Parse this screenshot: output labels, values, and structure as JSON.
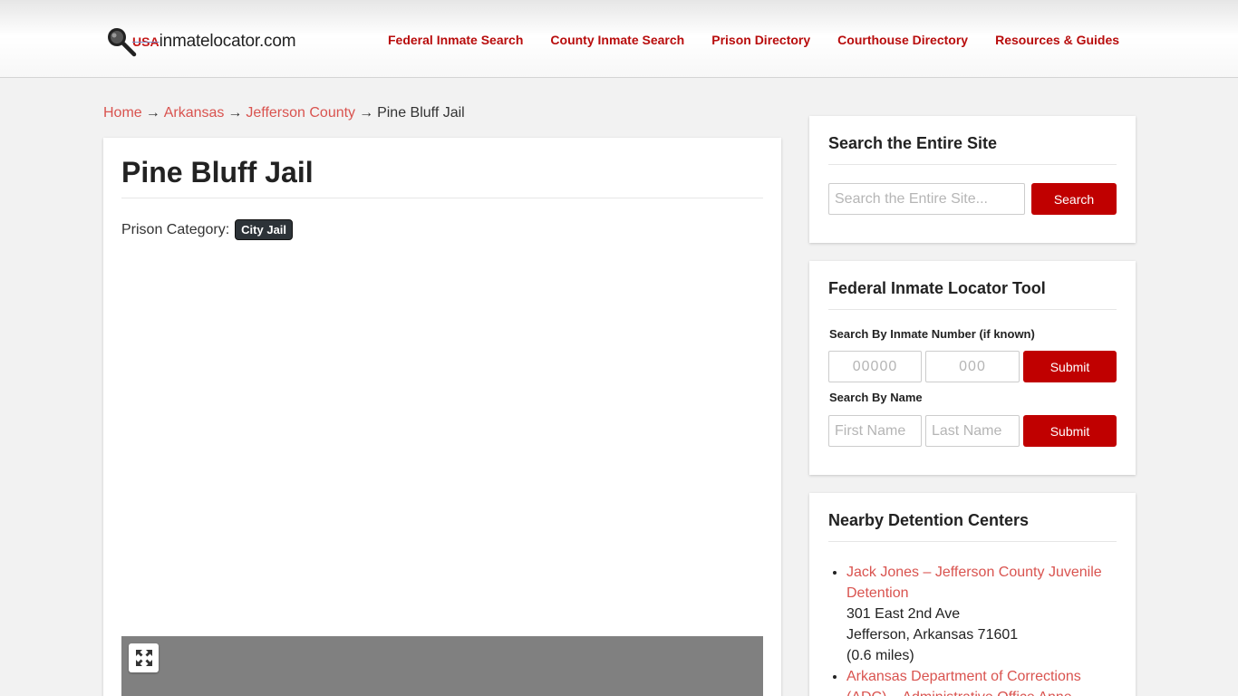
{
  "brand": {
    "logo_prefix": "USA",
    "logo_text": "inmatelocator.com"
  },
  "nav": {
    "items": [
      {
        "label": "Federal Inmate Search"
      },
      {
        "label": "County Inmate Search"
      },
      {
        "label": "Prison Directory"
      },
      {
        "label": "Courthouse Directory"
      },
      {
        "label": "Resources & Guides"
      }
    ]
  },
  "breadcrumb": {
    "home": "Home",
    "state": "Arkansas",
    "county": "Jefferson County",
    "current": "Pine Bluff Jail",
    "separator": "→"
  },
  "main": {
    "title": "Pine Bluff Jail",
    "category_label": "Prison Category:",
    "category_value": "City Jail"
  },
  "sidebar": {
    "search": {
      "title": "Search the Entire Site",
      "placeholder": "Search the Entire Site...",
      "button": "Search"
    },
    "federal": {
      "title": "Federal Inmate Locator Tool",
      "number_label": "Search By Inmate Number (if known)",
      "number_placeholder_1": "00000",
      "number_placeholder_2": "000",
      "submit_1": "Submit",
      "name_label": "Search By Name",
      "first_placeholder": "First Name",
      "last_placeholder": "Last Name",
      "submit_2": "Submit"
    },
    "nearby": {
      "title": "Nearby Detention Centers",
      "items": [
        {
          "name": "Jack Jones – Jefferson County Juvenile Detention",
          "address": "301 East 2nd Ave",
          "city": "Jefferson, Arkansas 71601",
          "distance": "(0.6 miles)"
        },
        {
          "name": "Arkansas Department of Corrections (ADC) – Administrative Office Anne"
        }
      ]
    }
  },
  "colors": {
    "nav_link": "#b80c0c",
    "link": "#d9534f",
    "button": "#c00000",
    "badge": "#2d3338",
    "map": "#808080"
  }
}
